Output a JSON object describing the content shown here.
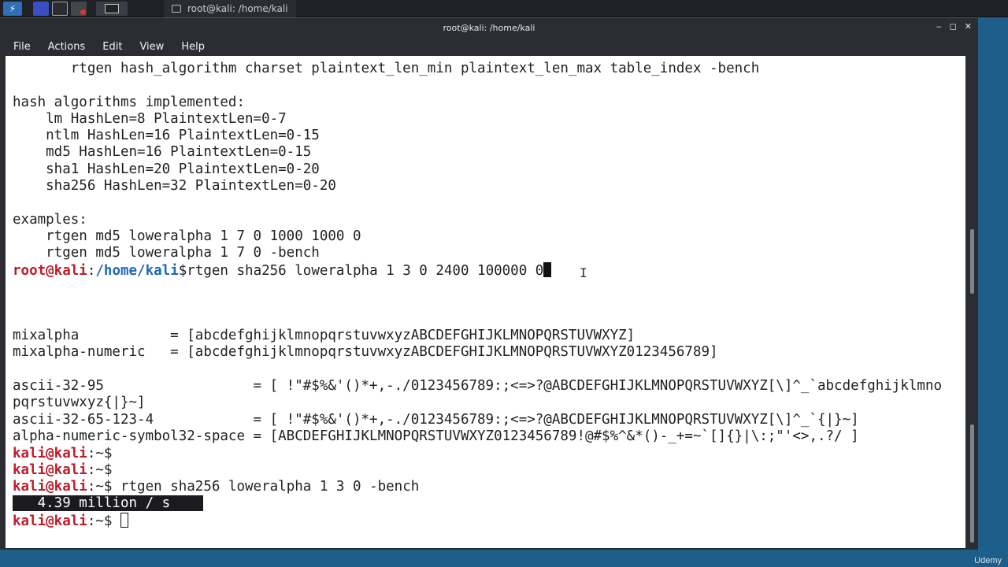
{
  "taskbar": {
    "active_task_label": "root@kali: /home/kali"
  },
  "window": {
    "title": "root@kali: /home/kali",
    "controls": {
      "minimize": "‒",
      "maximize": "◻",
      "close": "✕"
    }
  },
  "menu": {
    "file": "File",
    "actions": "Actions",
    "edit": "Edit",
    "view": "View",
    "help": "Help"
  },
  "top_pane": {
    "usage_line": "       rtgen hash_algorithm charset plaintext_len_min plaintext_len_max table_index -bench",
    "algos_header": "hash algorithms implemented:",
    "algos": [
      "    lm HashLen=8 PlaintextLen=0-7",
      "    ntlm HashLen=16 PlaintextLen=0-15",
      "    md5 HashLen=16 PlaintextLen=0-15",
      "    sha1 HashLen=20 PlaintextLen=0-20",
      "    sha256 HashLen=32 PlaintextLen=0-20"
    ],
    "examples_header": "examples:",
    "examples": [
      "    rtgen md5 loweralpha 1 7 0 1000 1000 0",
      "    rtgen md5 loweralpha 1 7 0 -bench"
    ],
    "prompt_user": "root@kali",
    "prompt_sep": ":",
    "prompt_path": "/home/kali",
    "prompt_sym": "$",
    "command": "rtgen sha256 loweralpha 1 3 0 2400 100000 0"
  },
  "bottom_pane": {
    "charset_lines": [
      "mixalpha           = [abcdefghijklmnopqrstuvwxyzABCDEFGHIJKLMNOPQRSTUVWXYZ]",
      "mixalpha-numeric   = [abcdefghijklmnopqrstuvwxyzABCDEFGHIJKLMNOPQRSTUVWXYZ0123456789]",
      "",
      "ascii-32-95                  = [ !\"#$%&'()*+,-./0123456789:;<=>?@ABCDEFGHIJKLMNOPQRSTUVWXYZ[\\]^_`abcdefghijklmno",
      "pqrstuvwxyz{|}~]",
      "ascii-32-65-123-4            = [ !\"#$%&'()*+,-./0123456789:;<=>?@ABCDEFGHIJKLMNOPQRSTUVWXYZ[\\]^_`{|}~]",
      "alpha-numeric-symbol32-space = [ABCDEFGHIJKLMNOPQRSTUVWXYZ0123456789!@#$%^&*()-_+=~`[]{}|\\:;\"'<>,.?/ ]"
    ],
    "prompt_user": "kali@kali",
    "prompt_rest": ":~$",
    "bench_command": " rtgen sha256 loweralpha 1 3 0 -bench",
    "bench_result": "   4.39 million / s    "
  },
  "watermark": "Udemy"
}
